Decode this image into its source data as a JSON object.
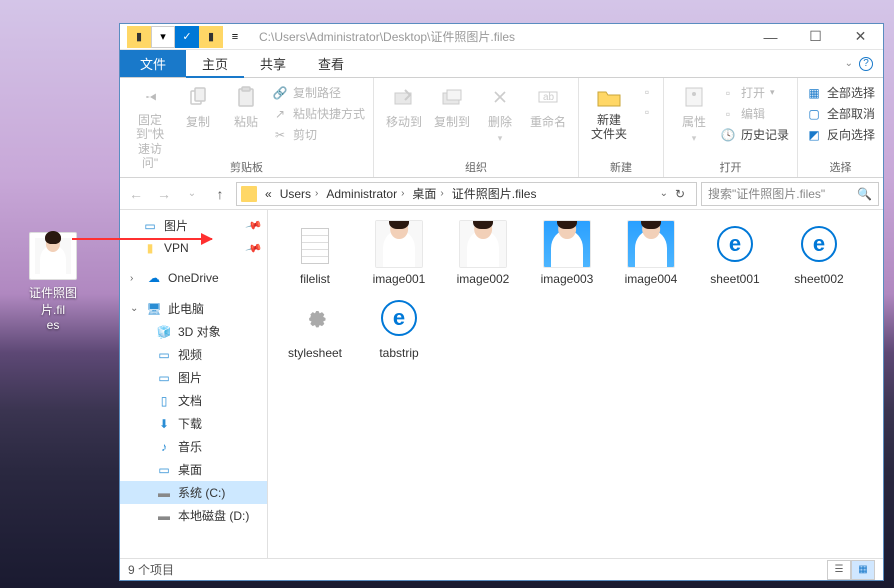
{
  "titlebar": {
    "path": "C:\\Users\\Administrator\\Desktop\\证件照图片.files"
  },
  "window_controls": {
    "min": "—",
    "max": "☐",
    "close": "✕"
  },
  "tabs": {
    "file": "文件",
    "home": "主页",
    "share": "共享",
    "view": "查看"
  },
  "ribbon": {
    "pin": "固定到\"快\n速访问\"",
    "copy": "复制",
    "paste": "粘贴",
    "copy_path": "复制路径",
    "paste_shortcut": "粘贴快捷方式",
    "cut": "剪切",
    "clipboard": "剪贴板",
    "move_to": "移动到",
    "copy_to": "复制到",
    "delete": "删除",
    "rename": "重命名",
    "organize": "组织",
    "new_folder": "新建\n文件夹",
    "new": "新建",
    "properties": "属性",
    "open": "打开",
    "edit": "编辑",
    "history": "历史记录",
    "open_group": "打开",
    "select_all": "全部选择",
    "select_none": "全部取消",
    "invert": "反向选择",
    "select": "选择"
  },
  "breadcrumb": {
    "seg0": "«",
    "seg1": "Users",
    "seg2": "Administrator",
    "seg3": "桌面",
    "seg4": "证件照图片.files"
  },
  "search": {
    "placeholder": "搜索\"证件照图片.files\""
  },
  "sidebar": {
    "pictures_qa": "图片",
    "vpn": "VPN",
    "onedrive": "OneDrive",
    "this_pc": "此电脑",
    "3d": "3D 对象",
    "videos": "视频",
    "pictures": "图片",
    "documents": "文档",
    "downloads": "下载",
    "music": "音乐",
    "desktop": "桌面",
    "system_c": "系统 (C:)",
    "disk_d": "本地磁盘 (D:)"
  },
  "files": {
    "f1": "filelist",
    "f2": "image001",
    "f3": "image002",
    "f4": "image003",
    "f5": "image004",
    "f6": "sheet001",
    "f7": "sheet002",
    "f8": "stylesheet",
    "f9": "tabstrip"
  },
  "status": {
    "count": "9 个项目"
  },
  "desktop": {
    "folder": "证件照图片.fil\nes"
  }
}
